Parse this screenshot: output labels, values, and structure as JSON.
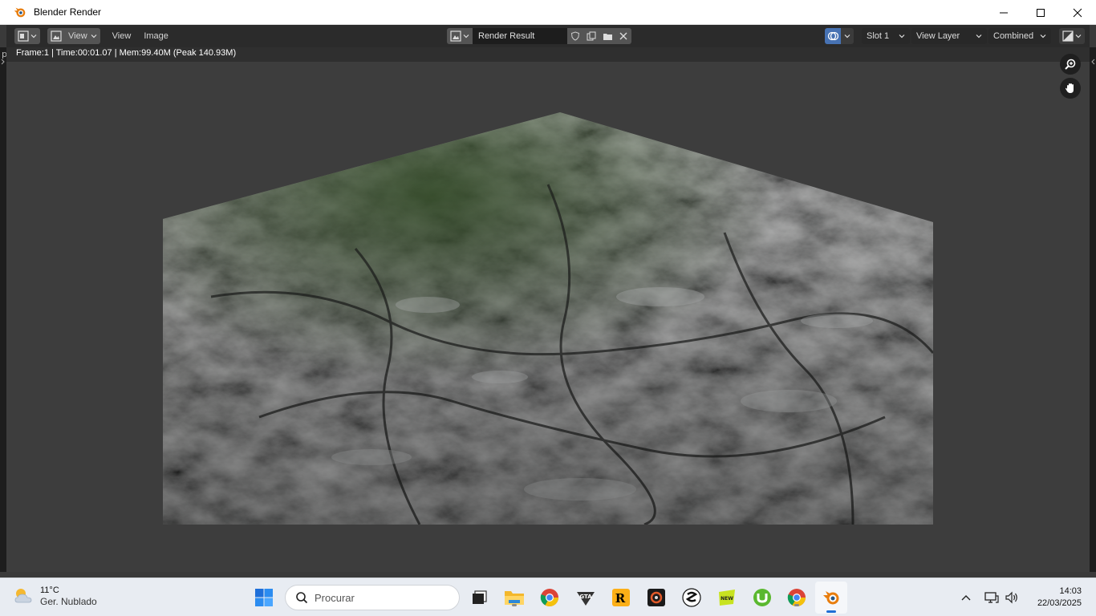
{
  "window": {
    "title": "Blender Render",
    "minimize_icon": "minimize-icon",
    "maximize_icon": "maximize-icon",
    "close_icon": "close-icon"
  },
  "header": {
    "editor_type_icon": "image-editor-icon",
    "view_mode_label": "View",
    "menus": [
      "View",
      "Image"
    ],
    "image_name": "Render Result",
    "slot": "Slot 1",
    "view_layer": "View Layer",
    "pass": "Combined"
  },
  "editor": {
    "stats": "Frame:1 | Time:00:01.07 | Mem:99.40M (Peak 140.93M)"
  },
  "taskbar": {
    "weather_temp": "11°C",
    "weather_cond": "Ger. Nublado",
    "search_placeholder": "Procurar",
    "time": "14:03",
    "date": "22/03/2025",
    "apps": [
      "task-view",
      "file-explorer",
      "chrome",
      "gta-v",
      "rockstar-launcher",
      "davinci-resolve",
      "steam",
      "obs",
      "utorrent",
      "chrome",
      "blender"
    ]
  },
  "colors": {
    "blender_orange": "#e87d0d",
    "header_bg": "#2b2b2b",
    "editor_bg": "#3d3d3d",
    "accent_blue": "#4772b3"
  }
}
